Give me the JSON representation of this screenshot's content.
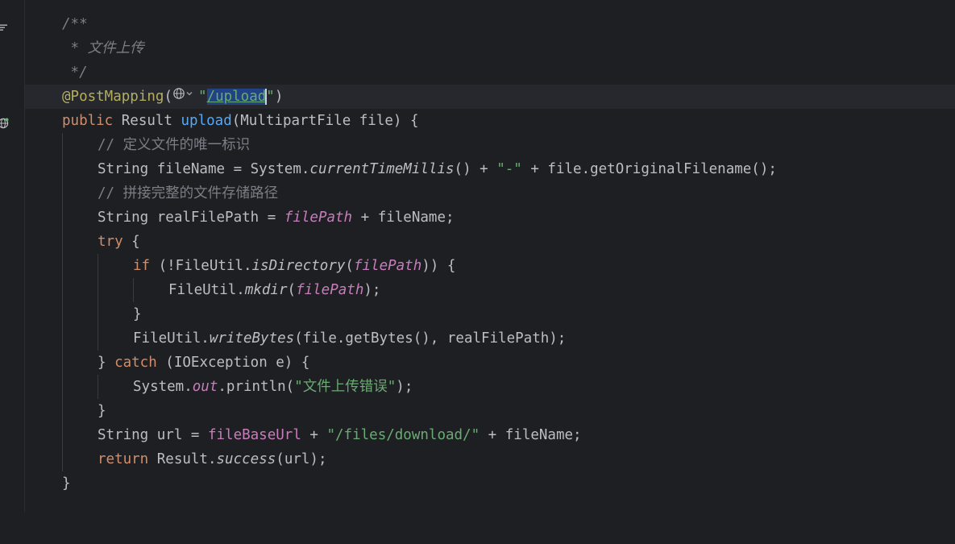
{
  "editor": {
    "language": "java",
    "lines": {
      "l1": {
        "comment": "/**"
      },
      "l2": {
        "comment": " * 文件上传"
      },
      "l3": {
        "comment": " */"
      },
      "l4": {
        "annotation": "@PostMapping",
        "open": "(",
        "quote_open": "\"",
        "path_slash": "/",
        "path_selected": "upload",
        "quote_close": "\"",
        "close": ")"
      },
      "l5": {
        "kw": "public",
        "type": " Result ",
        "method": "upload",
        "params": "(MultipartFile file) {"
      },
      "l6": {
        "comment": "// 定义文件的唯一标识"
      },
      "l7": {
        "a": "String fileName = System.",
        "b": "currentTimeMillis",
        "c": "() + ",
        "d": "\"-\"",
        "e": " + file.getOriginalFilename();"
      },
      "l8": {
        "comment": "// 拼接完整的文件存储路径"
      },
      "l9": {
        "a": "String realFilePath = ",
        "b": "filePath",
        "c": " + fileName;"
      },
      "l10": {
        "kw": "try",
        "b": " {"
      },
      "l11": {
        "kw": "if",
        "a": " (!FileUtil.",
        "b": "isDirectory",
        "c": "(",
        "d": "filePath",
        "e": ")) {"
      },
      "l12": {
        "a": "FileUtil.",
        "b": "mkdir",
        "c": "(",
        "d": "filePath",
        "e": ");"
      },
      "l13": {
        "a": "}"
      },
      "l14": {
        "a": "FileUtil.",
        "b": "writeBytes",
        "c": "(file.getBytes(), realFilePath);"
      },
      "l15": {
        "a": "} ",
        "kw": "catch",
        "b": " (IOException e) {"
      },
      "l16": {
        "a": "System.",
        "b": "out",
        "c": ".println(",
        "d": "\"文件上传错误\"",
        "e": ");"
      },
      "l17": {
        "a": "}"
      },
      "l18": {
        "a": "String url = ",
        "b": "fileBaseUrl",
        "c": " + ",
        "d": "\"/files/download/\"",
        "e": " + fileName;"
      },
      "l19": {
        "kw": "return",
        "a": " Result.",
        "b": "success",
        "c": "(url);"
      },
      "l20": {
        "a": "}"
      }
    }
  },
  "icons": {
    "endpoint_globe": "globe-icon",
    "endpoint_dropdown": "chevron-down-icon",
    "gutter_structure": "structure-icon",
    "gutter_endpoint": "web-endpoint-gutter-icon"
  },
  "colors": {
    "background": "#1e1f22",
    "keyword": "#cf8e6d",
    "string": "#6aab73",
    "method_decl": "#56a8f5",
    "field": "#c77dbb",
    "annotation": "#b3ae60",
    "comment": "#7a7e85",
    "selection": "#214283"
  }
}
